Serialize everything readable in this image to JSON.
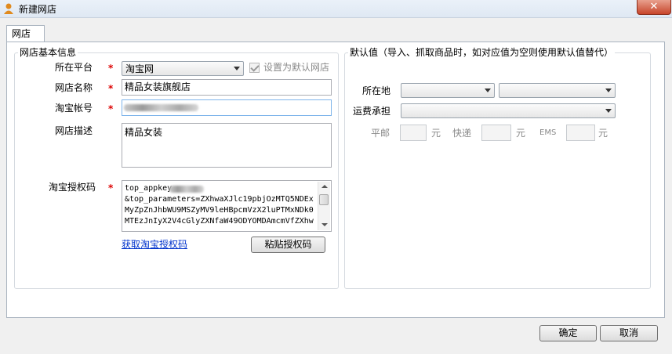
{
  "window": {
    "title": "新建网店",
    "close_symbol": "✕"
  },
  "tab": {
    "label": "网店"
  },
  "basic": {
    "legend": "网店基本信息",
    "platform_label": "所在平台",
    "platform_value": "淘宝网",
    "default_shop_label": "设置为默认网店",
    "shop_name_label": "网店名称",
    "shop_name_value": "精品女装旗舰店",
    "account_label": "淘宝帐号",
    "description_label": "网店描述",
    "description_value": "精品女装",
    "auth_label": "淘宝授权码",
    "auth_lines": [
      "top_appkey",
      "&top_parameters=ZXhwaXJlc19pbjOzMTQ5NDEx",
      "MyZpZnJhbWU9MSZyMV9leHBpcmVzX2luPTMxNDk0",
      "MTEzJnIyX2V4cGlyZXNfaW49ODYOMDAmcmVfZXhw"
    ],
    "get_auth_link": "获取淘宝授权码",
    "paste_button": "粘贴授权码",
    "required_mark": "*"
  },
  "defaults": {
    "legend": "默认值（导入、抓取商品时，如对应值为空则使用默认值替代）",
    "location_label": "所在地",
    "shipping_label": "运费承担",
    "post_label": "平邮",
    "express_label": "快递",
    "ems_label": "EMS",
    "unit": "元"
  },
  "footer": {
    "ok_button": "确定",
    "cancel_button": "取消"
  }
}
